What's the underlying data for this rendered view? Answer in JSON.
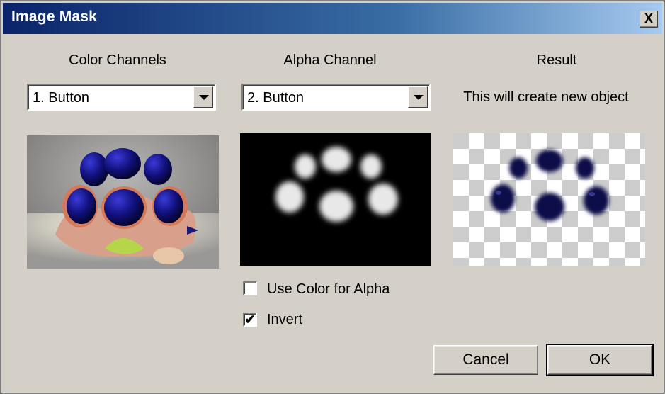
{
  "window": {
    "title": "Image Mask",
    "close_glyph": "X"
  },
  "color_channels": {
    "heading": "Color Channels",
    "selected": "1. Button"
  },
  "alpha_channel": {
    "heading": "Alpha Channel",
    "selected": "2. Button",
    "use_color_label": "Use Color for Alpha",
    "use_color_checked": false,
    "invert_label": "Invert",
    "invert_checked": true,
    "check_glyph": "✔"
  },
  "result": {
    "heading": "Result",
    "note": "This will create new object"
  },
  "buttons": {
    "cancel": "Cancel",
    "ok": "OK"
  }
}
